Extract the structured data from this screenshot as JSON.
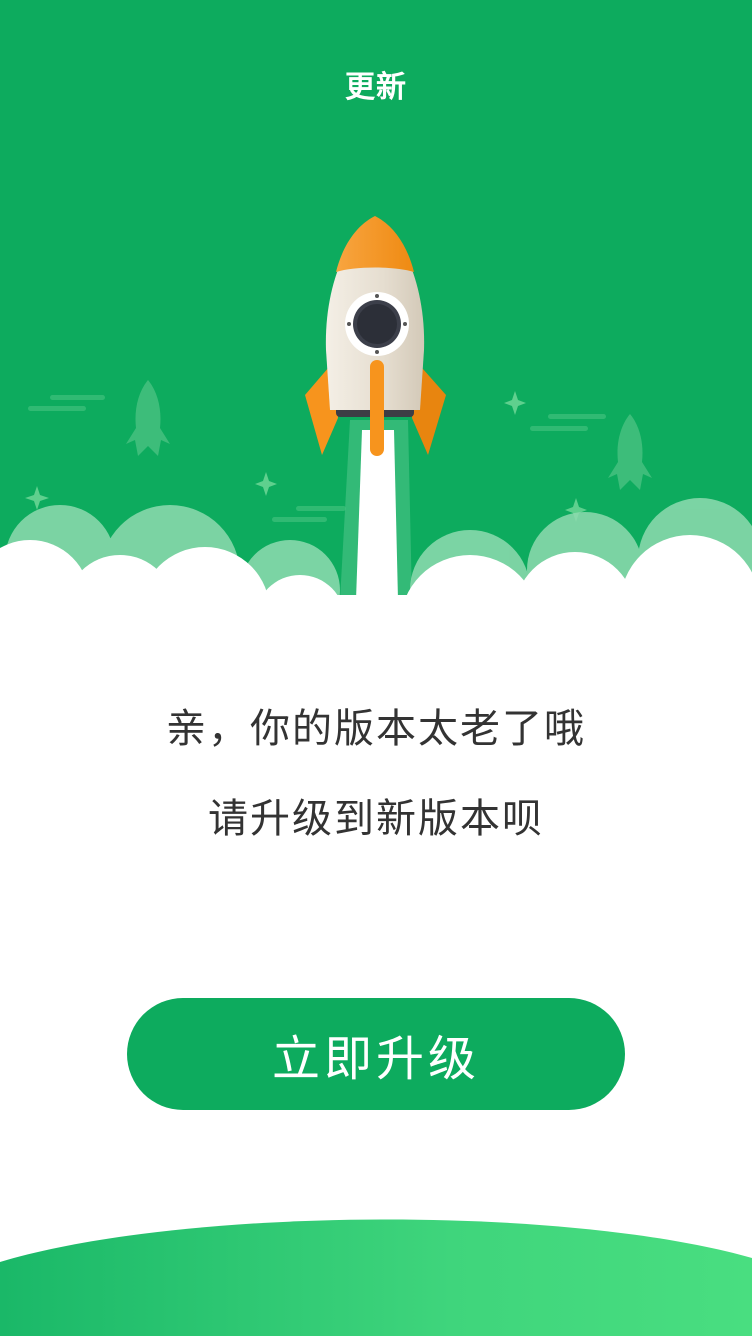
{
  "header": {
    "title": "更新"
  },
  "message": {
    "line1": "亲，你的版本太老了哦",
    "line2": "请升级到新版本呗"
  },
  "upgrade_button": {
    "label": "立即升级"
  },
  "colors": {
    "primary_green": "#0dab5e",
    "light_green": "#46db7e",
    "rocket_orange": "#f7941d",
    "rocket_body": "#e8e1d4"
  },
  "icons": [
    "rocket-illustration",
    "small-rocket-icon",
    "sparkle-icon",
    "cloud-shape"
  ]
}
